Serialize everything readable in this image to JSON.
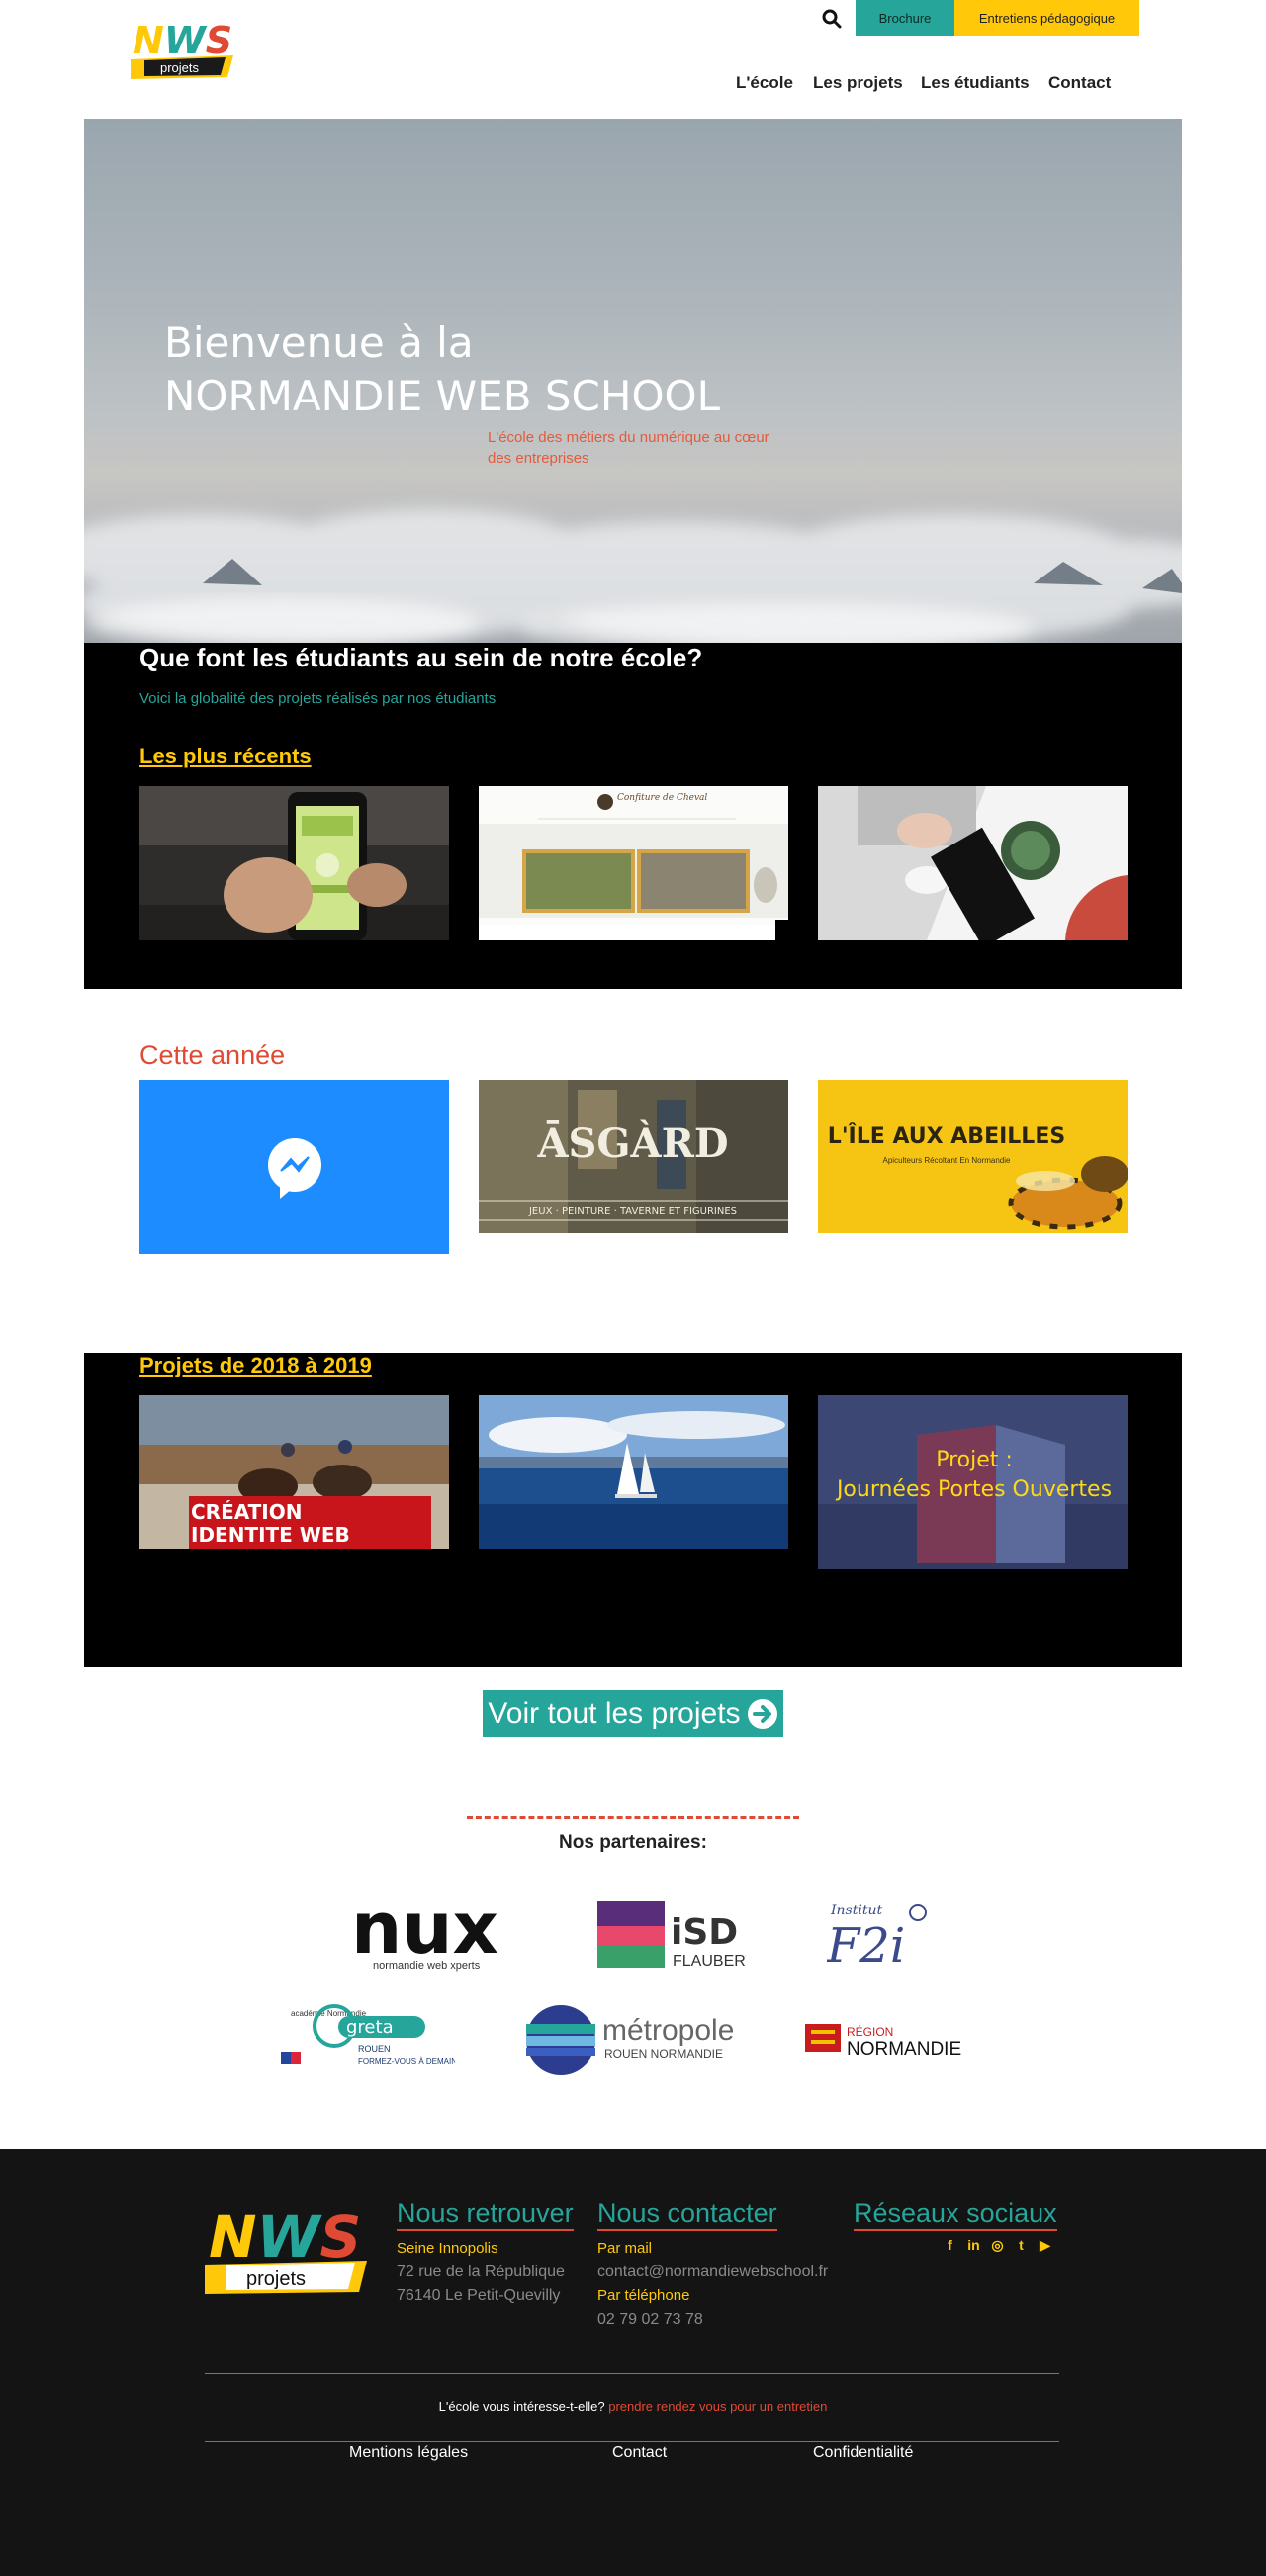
{
  "header": {
    "logo_text": "NWS",
    "logo_sub": "projets",
    "brochure_label": "Brochure",
    "entretiens_label": "Entretiens pédagogique",
    "nav": [
      "L'école",
      "Les projets",
      "Les étudiants",
      "Contact"
    ]
  },
  "hero": {
    "title_line1": "Bienvenue à la",
    "title_line2": "NORMANDIE WEB SCHOOL",
    "subtitle": "L'école des métiers du numérique au cœur des entreprises"
  },
  "intro": {
    "title": "Que font les étudiants au sein de notre école?",
    "subtitle": "Voici la globalité des projets réalisés par nos étudiants"
  },
  "recent": {
    "title": "Les plus récents",
    "site_header": "Confiture de Cheval"
  },
  "this_year": {
    "title": "Cette année",
    "asgard_title": "ĀSGÀRD",
    "asgard_sub": "JEUX · PEINTURE · TAVERNE ET FIGURINES",
    "abeilles_title": "L'ÎLE AUX ABEILLES",
    "abeilles_sub": "Apiculteurs Récoltant En Normandie"
  },
  "archive": {
    "title": "Projets de 2018 à 2019",
    "creation_line1": "CRÉATION",
    "creation_line2": "IDENTITE WEB",
    "jpo_line1": "Projet :",
    "jpo_line2": "Journées Portes Ouvertes"
  },
  "cta": {
    "label": "Voir tout les projets"
  },
  "partners": {
    "title": "Nos partenaires:",
    "nux": "nux",
    "nux_sub": "normandie web xperts",
    "isd": "iSD",
    "isd_sub": "FLAUBERT",
    "f2i_top": "Institut",
    "f2i": "F2i",
    "greta": "greta",
    "greta_rouen": "ROUEN",
    "greta_sub": "FORMEZ-VOUS À DEMAIN",
    "academie": "académie Normandie",
    "metropole": "métropole",
    "metropole_sub": "ROUEN NORMANDIE",
    "region_top": "RÉGION",
    "region": "NORMANDIE"
  },
  "footer": {
    "find_title": "Nous retrouver",
    "find_name": "Seine Innopolis",
    "find_addr1": "72 rue de la République",
    "find_addr2": "76140 Le Petit-Quevilly",
    "contact_title": "Nous contacter",
    "mail_label": "Par mail",
    "mail": "contact@normandiewebschool.fr",
    "phone_label": "Par téléphone",
    "phone": "02 79 02 73 78",
    "social_title": "Réseaux sociaux",
    "social": [
      "f",
      "in",
      "◎",
      "t",
      "▶"
    ],
    "interest_text": "L'école vous intéresse-t-elle?",
    "interest_link": "prendre rendez vous pour un entretien",
    "links": [
      "Mentions légales",
      "Contact",
      "Confidentialité"
    ]
  },
  "colors": {
    "teal": "#26a59a",
    "yellow": "#ffc90a",
    "red": "#e04a35",
    "footer_bg": "#141414"
  }
}
